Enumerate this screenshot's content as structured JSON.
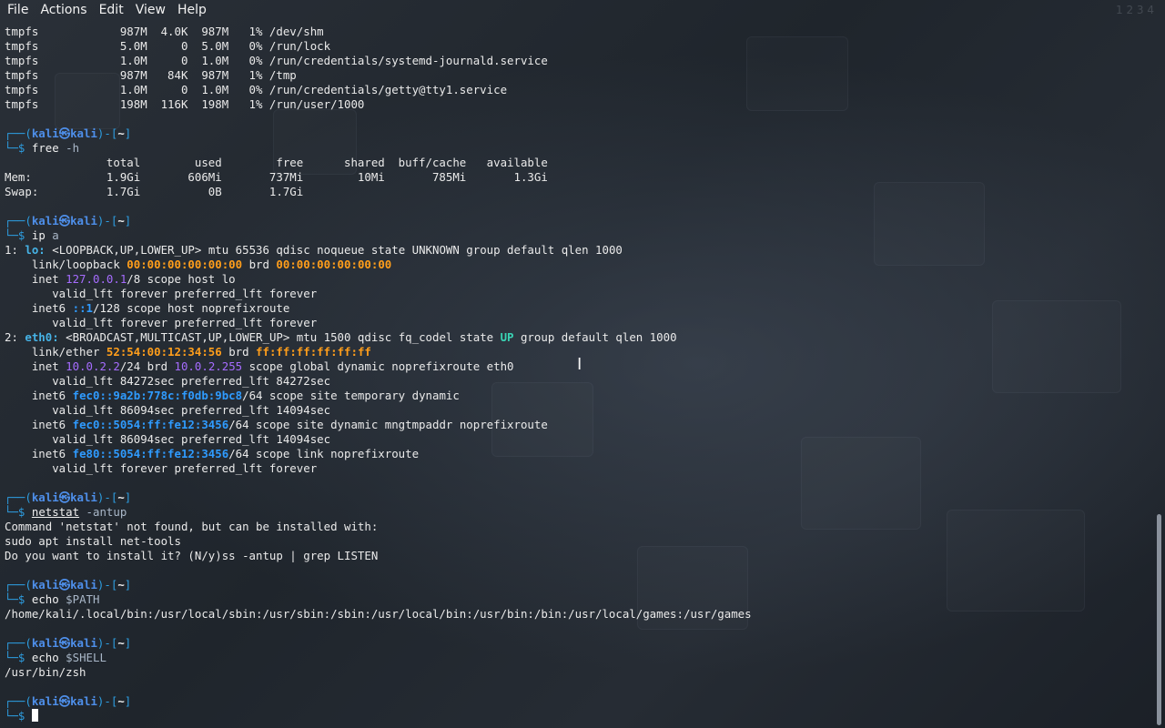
{
  "menubar": {
    "items": [
      "File",
      "Actions",
      "Edit",
      "View",
      "Help"
    ]
  },
  "terminal": {
    "df_rows": [
      [
        "tmpfs",
        "987M",
        "4.0K",
        "987M",
        "1%",
        "/dev/shm"
      ],
      [
        "tmpfs",
        "5.0M",
        "0",
        "5.0M",
        "0%",
        "/run/lock"
      ],
      [
        "tmpfs",
        "1.0M",
        "0",
        "1.0M",
        "0%",
        "/run/credentials/systemd-journald.service"
      ],
      [
        "tmpfs",
        "987M",
        "84K",
        "987M",
        "1%",
        "/tmp"
      ],
      [
        "tmpfs",
        "1.0M",
        "0",
        "1.0M",
        "0%",
        "/run/credentials/getty@tty1.service"
      ],
      [
        "tmpfs",
        "198M",
        "116K",
        "198M",
        "1%",
        "/run/user/1000"
      ]
    ],
    "prompt": {
      "top_left": "┌──(",
      "user": "kali",
      "at": "㉿",
      "host": "kali",
      "dir_open": ")-[",
      "dir": "~",
      "dir_close": "]",
      "bottom_left": "└─$"
    },
    "free": {
      "command": "free",
      "args": "-h",
      "header": "               total        used        free      shared  buff/cache   available",
      "mem": "Mem:           1.9Gi       606Mi       737Mi        10Mi       785Mi       1.3Gi",
      "swap": "Swap:          1.7Gi          0B       1.7Gi"
    },
    "ip": {
      "command": "ip",
      "args": "a",
      "lo_num": "1: ",
      "lo_name": "lo:",
      "lo_flags": " <LOOPBACK,UP,LOWER_UP> mtu 65536 qdisc noqueue state UNKNOWN group default qlen 1000",
      "lo_link_pre": "    link/loopback ",
      "lo_mac": "00:00:00:00:00:00",
      "lo_brd_word": " brd ",
      "lo_brd": "00:00:00:00:00:00",
      "lo_inet_pre": "    inet ",
      "lo_inet": "127.0.0.1",
      "lo_inet_post": "/8 scope host lo",
      "lo_valid1": "       valid_lft forever preferred_lft forever",
      "lo_inet6_pre": "    inet6 ",
      "lo_inet6": "::1",
      "lo_inet6_post": "/128 scope host noprefixroute",
      "lo_valid2": "       valid_lft forever preferred_lft forever",
      "eth_num": "2: ",
      "eth_name": "eth0:",
      "eth_flags": " <BROADCAST,MULTICAST,UP,LOWER_UP> mtu 1500 qdisc fq_codel state ",
      "eth_state": "UP",
      "eth_flags_post": " group default qlen 1000",
      "eth_link_pre": "    link/ether ",
      "eth_mac": "52:54:00:12:34:56",
      "eth_brd_word": " brd ",
      "eth_brd": "ff:ff:ff:ff:ff:ff",
      "eth_inet_pre": "    inet ",
      "eth_inet": "10.0.2.2",
      "eth_inet_mid": "/24 brd ",
      "eth_inet_brd": "10.0.2.255",
      "eth_inet_post": " scope global dynamic noprefixroute eth0",
      "eth_valid1": "       valid_lft 84272sec preferred_lft 84272sec",
      "eth_inet6a_pre": "    inet6 ",
      "eth_inet6a": "fec0::9a2b:778c:f0db:9bc8",
      "eth_inet6a_post": "/64 scope site temporary dynamic",
      "eth_valid2": "       valid_lft 86094sec preferred_lft 14094sec",
      "eth_inet6b_pre": "    inet6 ",
      "eth_inet6b": "fec0::5054:ff:fe12:3456",
      "eth_inet6b_post": "/64 scope site dynamic mngtmpaddr noprefixroute",
      "eth_valid3": "       valid_lft 86094sec preferred_lft 14094sec",
      "eth_inet6c_pre": "    inet6 ",
      "eth_inet6c": "fe80::5054:ff:fe12:3456",
      "eth_inet6c_post": "/64 scope link noprefixroute",
      "eth_valid4": "       valid_lft forever preferred_lft forever"
    },
    "netstat": {
      "command": "netstat",
      "args": "-antup",
      "out1": "Command 'netstat' not found, but can be installed with:",
      "out2": "sudo apt install net-tools",
      "out3": "Do you want to install it? (N/y)ss -antup | grep LISTEN"
    },
    "echo_path": {
      "command": "echo",
      "args": "$PATH",
      "out": "/home/kali/.local/bin:/usr/local/sbin:/usr/sbin:/sbin:/usr/local/bin:/usr/bin:/bin:/usr/local/games:/usr/games"
    },
    "echo_shell": {
      "command": "echo",
      "args": "$SHELL",
      "out": "/usr/bin/zsh"
    }
  },
  "icons": {
    "mouse_cursor": "i-beam-cursor-icon",
    "text_cursor": "block-cursor-icon"
  },
  "colors": {
    "prompt_frame": "#2d9de0",
    "prompt_user": "#4e8fea",
    "address_purple": "#a66cff",
    "mac_orange": "#ff9e1b",
    "iface_cyan": "#46b3e6",
    "state_up": "#3ad3b4",
    "ipv6_blue": "#2f9bff"
  }
}
